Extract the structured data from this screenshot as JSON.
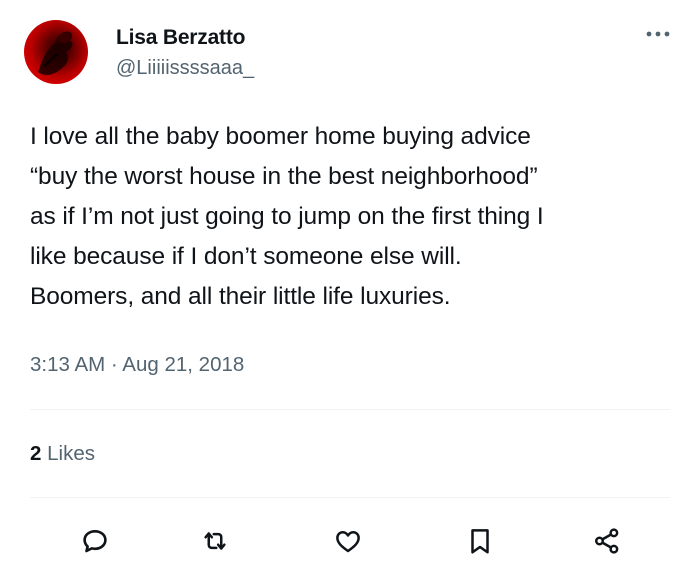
{
  "author": {
    "display_name": "Lisa Berzatto",
    "handle": "@Liiiiissssaaa_",
    "avatar_icon": "avatar-photo"
  },
  "tweet": {
    "lines": [
      "I love all the baby boomer home buying advice",
      "“buy the worst house in the best neighborhood”",
      "as if I’m not just going to jump on the first thing I",
      "like because if I don’t someone else will.",
      "Boomers, and all their little life luxuries."
    ],
    "timestamp": "3:13 AM · Aug 21, 2018"
  },
  "stats": {
    "likes_count": "2",
    "likes_label": "Likes"
  },
  "actions": [
    {
      "name": "reply",
      "icon": "reply-icon"
    },
    {
      "name": "retweet",
      "icon": "retweet-icon"
    },
    {
      "name": "like",
      "icon": "heart-icon"
    },
    {
      "name": "bookmark",
      "icon": "bookmark-icon"
    },
    {
      "name": "share",
      "icon": "share-icon"
    }
  ],
  "colors": {
    "text": "#0f1419",
    "secondary": "#536471",
    "divider": "#eff3f4",
    "avatar_red": "#e00000"
  }
}
